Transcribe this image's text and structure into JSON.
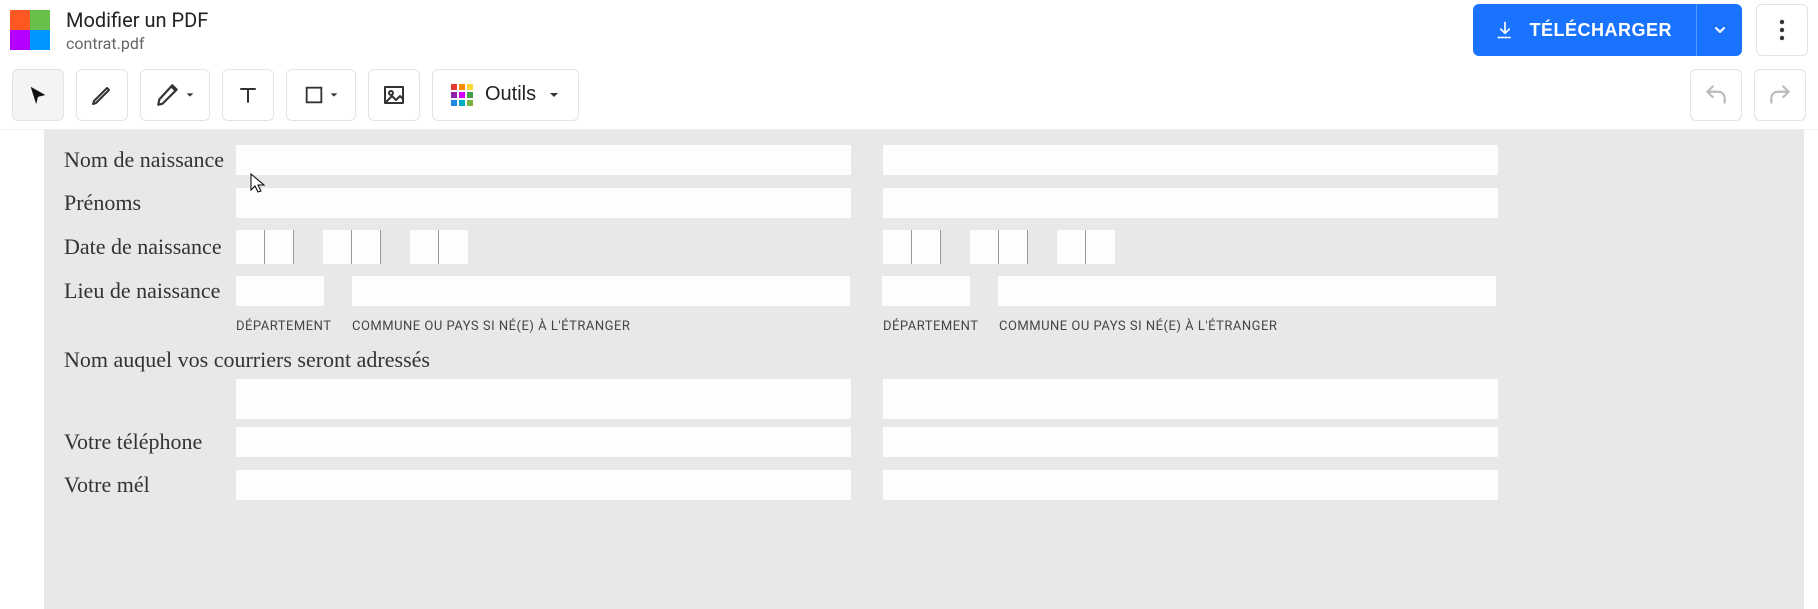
{
  "header": {
    "title": "Modifier un PDF",
    "filename": "contrat.pdf",
    "download_label": "TÉLÉCHARGER"
  },
  "toolbar": {
    "tools_label": "Outils"
  },
  "form": {
    "labels": {
      "nom_naissance": "Nom de naissance",
      "prenoms": "Prénoms",
      "date_naissance": "Date de naissance",
      "lieu_naissance": "Lieu de naissance",
      "departement": "DÉPARTEMENT",
      "commune": "COMMUNE OU PAYS SI NÉ(E) À L'ÉTRANGER",
      "nom_courrier": "Nom auquel vos courriers seront adressés",
      "telephone": "Votre téléphone",
      "mel": "Votre mél"
    }
  }
}
